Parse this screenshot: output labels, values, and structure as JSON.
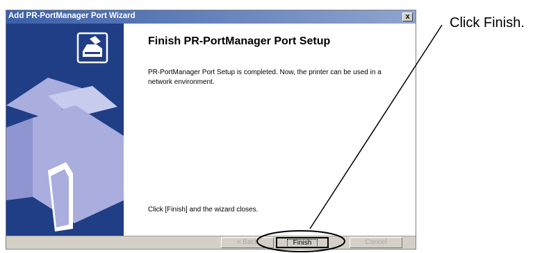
{
  "window": {
    "title": "Add PR-PortManager Port Wizard",
    "close_label": "x"
  },
  "content": {
    "heading": "Finish PR-PortManager Port Setup",
    "description": "PR-PortManager Port Setup is completed. Now, the printer can be used in a network environment.",
    "closing": "Click [Finish] and the wizard closes."
  },
  "buttons": {
    "back_label": "< Back",
    "finish_label": "Finish",
    "cancel_label": "Cancel"
  },
  "annotation": {
    "text": "Click Finish."
  },
  "colors": {
    "side_panel": "#1f3e86",
    "printer_art": "#a9aede",
    "titlebar_start": "#3b5fa8"
  }
}
